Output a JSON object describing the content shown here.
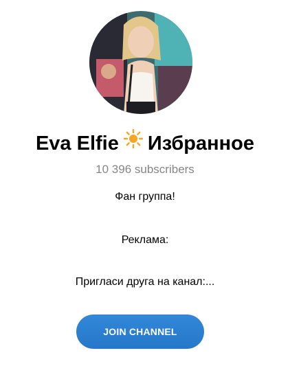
{
  "channel": {
    "name": "Eva Elfie",
    "emoji": "☀",
    "name_suffix": "Избранное",
    "subscribers": "10 396 subscribers",
    "description_lines": [
      "Фан группа!",
      "Реклама:",
      "Пригласи друга на канал:..."
    ]
  },
  "actions": {
    "join_label": "JOIN CHANNEL"
  },
  "colors": {
    "join_button": "#2a7cd0",
    "subscribers_text": "#868686",
    "sun_icon": "#f5a623"
  }
}
